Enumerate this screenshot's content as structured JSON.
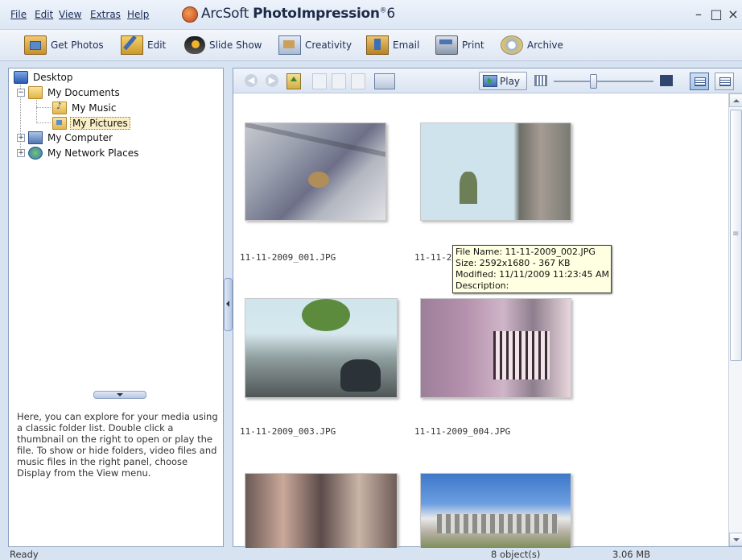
{
  "menu": {
    "file": "File",
    "edit": "Edit",
    "view": "View",
    "extras": "Extras",
    "help": "Help"
  },
  "app": {
    "title_regular": "ArcSoft ",
    "title_bold": "PhotoImpression",
    "title_reg": "®",
    "title_version": "6"
  },
  "window": {
    "minimize": "–",
    "maximize": "□",
    "close": "×"
  },
  "toolbar": {
    "get_photos": "Get Photos",
    "edit": "Edit",
    "slide_show": "Slide Show",
    "creativity": "Creativity",
    "email": "Email",
    "print": "Print",
    "archive": "Archive"
  },
  "tree": {
    "desktop": "Desktop",
    "my_documents": "My Documents",
    "my_music": "My Music",
    "my_pictures": "My Pictures",
    "my_computer": "My Computer",
    "my_network_places": "My Network Places",
    "expander_open": "−",
    "expander_closed": "+"
  },
  "help_text": "Here, you can explore for your media using a classic folder list. Double click a thumbnail on the right to open or play the file. To show or hide folders, video files and music files in the right panel, choose Display from the View menu.",
  "view_toolbar": {
    "play_label": "Play"
  },
  "thumbnails": [
    {
      "filename": "11-11-2009_001.JPG"
    },
    {
      "filename": "11-11-20"
    },
    {
      "filename": "11-11-2009_003.JPG"
    },
    {
      "filename": "11-11-2009_004.JPG"
    }
  ],
  "tooltip": {
    "file_name": "File Name: 11-11-2009_002.JPG",
    "size": "Size: 2592x1680 - 367 KB",
    "modified": "Modified: 11/11/2009 11:23:45 AM",
    "description": "Description:"
  },
  "status": {
    "ready": "Ready",
    "objects": "8 object(s)",
    "total_size": "3.06 MB"
  }
}
